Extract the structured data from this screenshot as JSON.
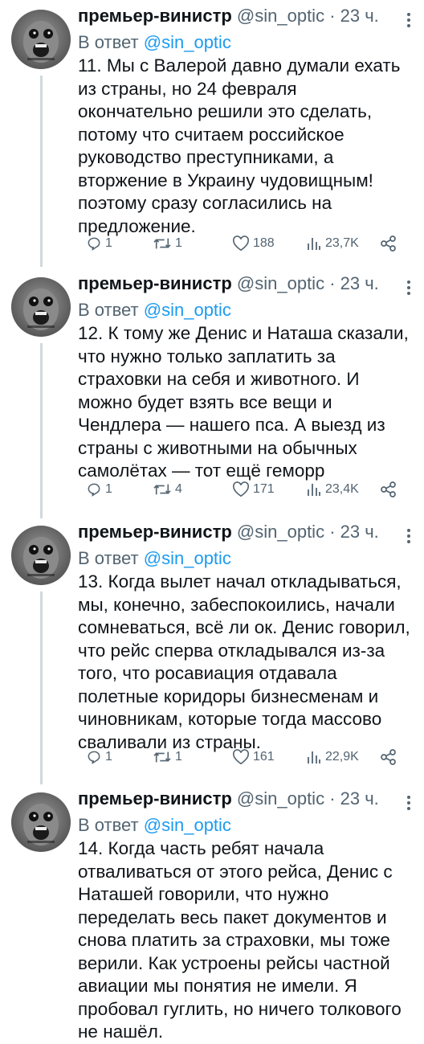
{
  "tweets": [
    {
      "author": "премьер-винистр",
      "handle": "@sin_optic",
      "time": "· 23 ч.",
      "reply_prefix": "В ответ",
      "reply_to": "@sin_optic",
      "text": "11. Мы с Валерой давно думали ехать\nиз страны, но 24 февраля\nокончательно решили это сделать,\nпотому что считаем российское\nруководство преступниками, а\nвторжение в Украину чудовищным!\nпоэтому сразу согласились на\nпредложение.",
      "replies": "1",
      "retweets": "1",
      "likes": "188",
      "views": "23,7K"
    },
    {
      "author": "премьер-винистр",
      "handle": "@sin_optic",
      "time": "· 23 ч.",
      "reply_prefix": "В ответ",
      "reply_to": "@sin_optic",
      "text": "12. К тому же Денис и Наташа сказали,\nчто нужно только заплатить за\nстраховки на себя и животного. И\nможно будет взять все вещи и\nЧендлера — нашего пса. А выезд из\nстраны с животными на обычных\nсамолётах — тот ещё геморр",
      "replies": "1",
      "retweets": "4",
      "likes": "171",
      "views": "23,4K"
    },
    {
      "author": "премьер-винистр",
      "handle": "@sin_optic",
      "time": "· 23 ч.",
      "reply_prefix": "В ответ",
      "reply_to": "@sin_optic",
      "text": "13. Когда вылет начал откладываться,\nмы, конечно, забеспокоились, начали\nсомневаться, всё ли ок. Денис говорил,\nчто рейс сперва откладывался из-за\nтого, что росавиация отдавала\nполетные коридоры бизнесменам и\nчиновникам, которые тогда массово\nсваливали из страны.",
      "replies": "1",
      "retweets": "1",
      "likes": "161",
      "views": "22,9K"
    },
    {
      "author": "премьер-винистр",
      "handle": "@sin_optic",
      "time": "· 23 ч.",
      "reply_prefix": "В ответ",
      "reply_to": "@sin_optic",
      "text": "14. Когда часть ребят начала\nотваливаться от этого рейса, Денис с\nНаташей говорили, что нужно\nпеределать весь пакет документов и\nснова платить за страховки, мы тоже\nверили. Как устроены рейсы частной\nавиации мы понятия не имели. Я\nпробовал гуглить, но ничего толкового\nне нашёл."
    }
  ],
  "icons": {
    "reply": "reply-icon",
    "retweet": "retweet-icon",
    "like": "heart-icon",
    "views": "views-icon",
    "share": "share-icon",
    "more": "more-icon"
  },
  "colors": {
    "text": "#0f1419",
    "secondary": "#536471",
    "link": "#1d9bf0",
    "thread_line": "#cfd9de"
  }
}
